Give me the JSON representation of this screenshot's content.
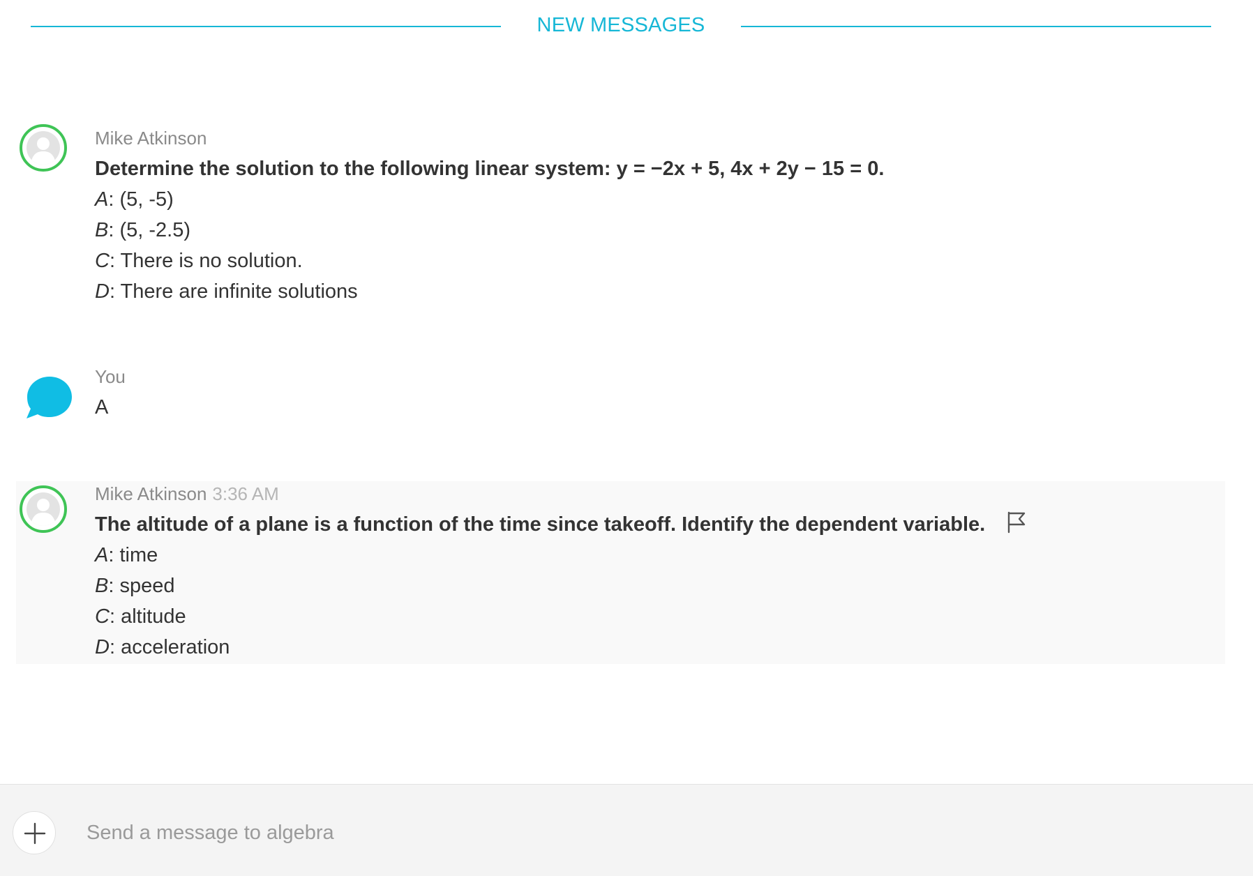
{
  "divider": {
    "label": "NEW MESSAGES"
  },
  "colors": {
    "accent": "#16b7d6",
    "avatar_ring": "#3fc456",
    "you_bubble": "#10bde4",
    "highlight_bg": "#f9f9f9"
  },
  "messages": [
    {
      "sender": "Mike Atkinson",
      "avatar_icon": "user-icon",
      "question": "Determine the solution to the following linear system: y = −2x + 5, 4x + 2y − 15 = 0.",
      "options": [
        {
          "letter": "A",
          "text": ": (5, -5)"
        },
        {
          "letter": "B",
          "text": ": (5, -2.5)"
        },
        {
          "letter": "C",
          "text": ": There is no solution."
        },
        {
          "letter": "D",
          "text": ": There are infinite solutions"
        }
      ]
    },
    {
      "sender": "You",
      "avatar_icon": "chat-bubble-icon",
      "text": "A"
    },
    {
      "sender": "Mike Atkinson",
      "timestamp": "3:36 AM",
      "avatar_icon": "user-icon",
      "question": "The altitude of a plane is a function of the time since takeoff. Identify the dependent variable.",
      "flag_icon": "flag-icon",
      "options": [
        {
          "letter": "A",
          "text": ": time"
        },
        {
          "letter": "B",
          "text": ": speed"
        },
        {
          "letter": "C",
          "text": ": altitude"
        },
        {
          "letter": "D",
          "text": ": acceleration"
        }
      ]
    }
  ],
  "composer": {
    "add_icon": "plus-icon",
    "placeholder": "Send a message to algebra",
    "value": ""
  }
}
